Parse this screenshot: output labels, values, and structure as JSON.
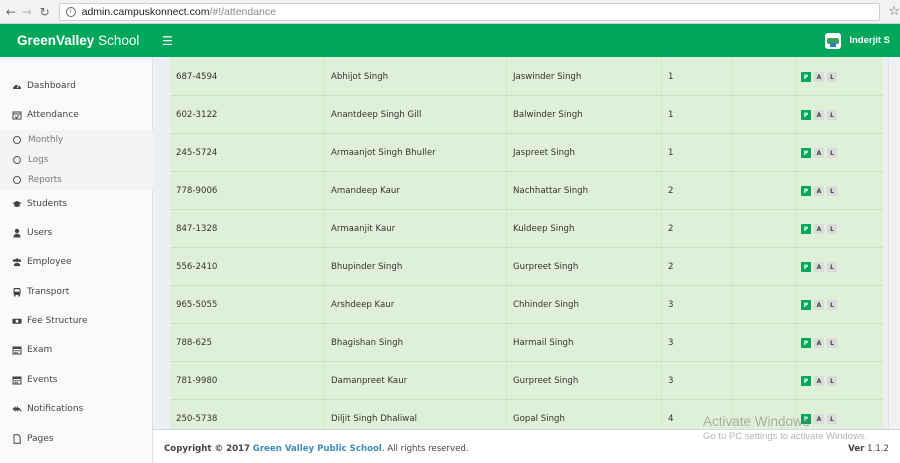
{
  "browser": {
    "url_host": "admin.campuskonnect.com",
    "url_path": "/#!/attendance"
  },
  "header": {
    "brand_bold": "GreenValley",
    "brand_rest": " School",
    "user_name": "Inderjit S"
  },
  "sidebar": {
    "items": [
      {
        "label": "Dashboard",
        "icon": "dashboard-icon"
      },
      {
        "label": "Attendance",
        "icon": "calendar-check-icon"
      },
      {
        "label": "Students",
        "icon": "graduation-cap-icon"
      },
      {
        "label": "Users",
        "icon": "user-icon"
      },
      {
        "label": "Employee",
        "icon": "users-icon"
      },
      {
        "label": "Transport",
        "icon": "bus-icon"
      },
      {
        "label": "Fee Structure",
        "icon": "money-icon"
      },
      {
        "label": "Exam",
        "icon": "calendar-icon"
      },
      {
        "label": "Events",
        "icon": "calendar-icon"
      },
      {
        "label": "Notifications",
        "icon": "reply-all-icon"
      },
      {
        "label": "Pages",
        "icon": "file-icon"
      }
    ],
    "attendance_sub": [
      "Monthly",
      "Logs",
      "Reports"
    ]
  },
  "table": {
    "rows": [
      {
        "id": "687-4594",
        "name": "Abhijot Singh",
        "parent": "Jaswinder Singh",
        "num": "1"
      },
      {
        "id": "602-3122",
        "name": "Anantdeep Singh Gill",
        "parent": "Balwinder Singh",
        "num": "1"
      },
      {
        "id": "245-5724",
        "name": "Armaanjot Singh Bhuller",
        "parent": "Jaspreet Singh",
        "num": "1"
      },
      {
        "id": "778-9006",
        "name": "Amandeep Kaur",
        "parent": "Nachhattar Singh",
        "num": "2"
      },
      {
        "id": "847-1328",
        "name": "Armaanjit Kaur",
        "parent": "Kuldeep Singh",
        "num": "2"
      },
      {
        "id": "556-2410",
        "name": "Bhupinder Singh",
        "parent": "Gurpreet Singh",
        "num": "2"
      },
      {
        "id": "965-5055",
        "name": "Arshdeep Kaur",
        "parent": "Chhinder Singh",
        "num": "3"
      },
      {
        "id": "788-625",
        "name": "Bhagishan Singh",
        "parent": "Harmail Singh",
        "num": "3"
      },
      {
        "id": "781-9980",
        "name": "Damanpreet Kaur",
        "parent": "Gurpreet Singh",
        "num": "3"
      },
      {
        "id": "250-5738",
        "name": "Diljit Singh Dhaliwal",
        "parent": "Gopal Singh",
        "num": "4"
      }
    ],
    "attendance_buttons": [
      "P",
      "A",
      "L"
    ]
  },
  "footer": {
    "copyright_label": "Copyright © 2017",
    "school_name": "Green Valley Public School",
    "rights": ". All rights reserved.",
    "version_label": "Ver",
    "version_number": "1.1.2"
  },
  "watermark": {
    "title": "Activate Windows",
    "subtitle": "Go to PC settings to activate Windows."
  },
  "colors": {
    "brand_green": "#00a65a",
    "row_green": "#dff0d8",
    "link_blue": "#3c8dbc"
  }
}
